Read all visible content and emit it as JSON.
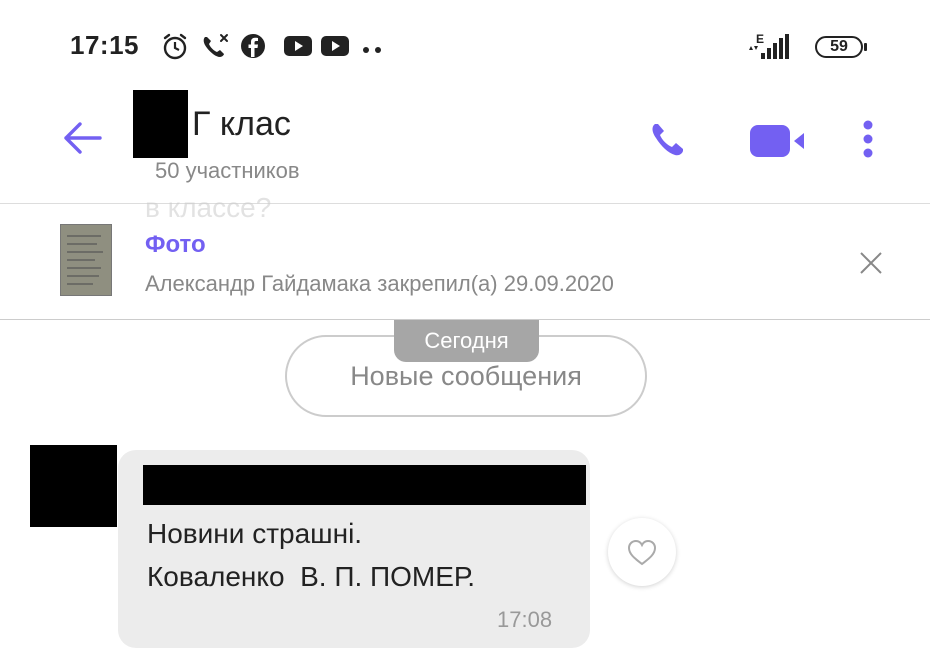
{
  "status_bar": {
    "time": "17:15",
    "network_label": "E",
    "battery_level": "59",
    "icons": [
      "alarm-icon",
      "missed-call-icon",
      "facebook-icon",
      "youtube-icon",
      "youtube-icon",
      "more-notifications-icon",
      "signal-icon",
      "battery-icon"
    ]
  },
  "header": {
    "title": "Г клас",
    "participants": "50 участников",
    "icons": [
      "back-icon",
      "call-icon",
      "video-call-icon",
      "menu-icon"
    ]
  },
  "pinned": {
    "ghost_text": "в классе?",
    "type_label": "Фото",
    "info": "Александр Гайдамака закрепил(а) 29.09.2020",
    "icons": [
      "pinned-thumbnail",
      "close-icon"
    ]
  },
  "divider": {
    "date_label": "Сегодня",
    "new_messages_label": "Новые сообщения"
  },
  "message": {
    "line1": "Новини страшні.",
    "line2": "Коваленко  В. П. ПОМЕР.",
    "time": "17:08",
    "icons": [
      "heart-icon"
    ]
  },
  "colors": {
    "accent": "#7360f2",
    "bubble": "#ececec",
    "date_chip": "#a6a6a6"
  }
}
